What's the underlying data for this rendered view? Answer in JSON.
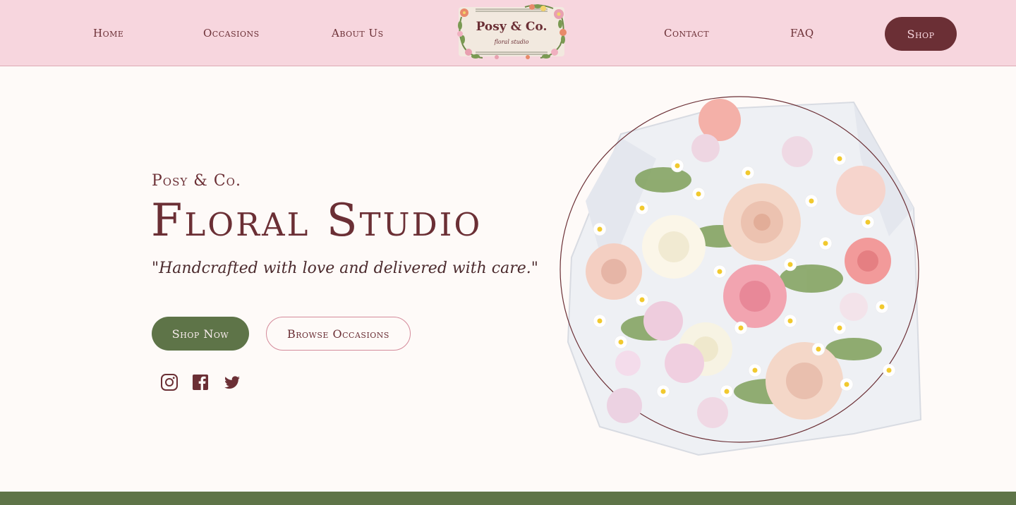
{
  "nav": {
    "links": [
      "Home",
      "Occasions",
      "About Us",
      "Contact",
      "FAQ"
    ],
    "shop_label": "Shop",
    "logo": {
      "title": "Posy & Co.",
      "subtitle": "floral studio"
    }
  },
  "hero": {
    "brand": "Posy & Co.",
    "title": "Floral Studio",
    "tagline": "\"Handcrafted with love and delivered with care.\"",
    "primary_button": "Shop Now",
    "secondary_button": "Browse Occasions",
    "social": [
      "instagram-icon",
      "facebook-icon",
      "twitter-icon"
    ]
  },
  "colors": {
    "nav_bg": "#f7d6de",
    "burgundy": "#6b2f35",
    "sage_green": "#5e7448",
    "page_bg": "#fefaf8",
    "pink_outline": "#d48a9a"
  }
}
